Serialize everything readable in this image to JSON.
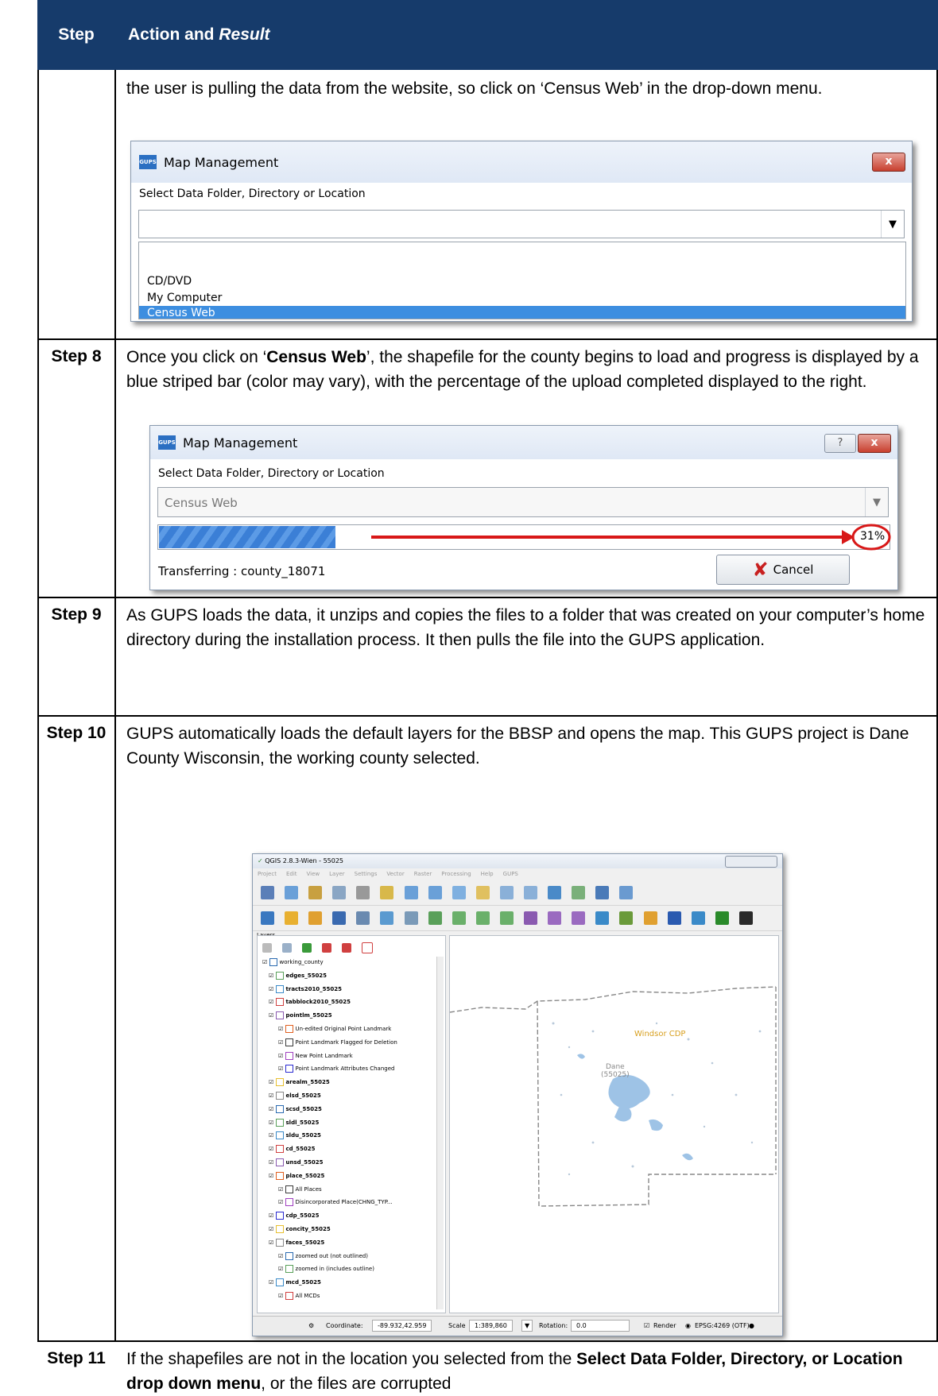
{
  "header": {
    "step": "Step",
    "action": "Action and ",
    "result": "Result"
  },
  "row0": {
    "text": "the user is pulling the data from the website, so click on ‘Census Web’ in the drop-down menu."
  },
  "dialog1": {
    "title": "Map Management",
    "close": "x",
    "label": "Select Data Folder, Directory or Location",
    "options": [
      "CD/DVD",
      "My Computer",
      "Census Web"
    ]
  },
  "step8": {
    "label": "Step 8",
    "t1": "Once you click on ‘",
    "bold": "Census Web",
    "t2": "’, the shapefile for the county begins to load and progress is displayed by a blue striped bar (color may vary), with the percentage of the upload completed displayed to the right."
  },
  "dialog2": {
    "title": "Map Management",
    "help": "?",
    "close": "x",
    "label": "Select Data Folder, Directory or Location",
    "combo_value": "Census Web",
    "progress": 31,
    "percent": "31%",
    "status": "Transferring : county_18071",
    "cancel": "Cancel"
  },
  "step9": {
    "label": "Step 9",
    "text": "As GUPS loads the data, it unzips and copies the files to a folder that was created on your computer’s home directory during the installation process. It then pulls the file into the GUPS application."
  },
  "step10": {
    "label": "Step 10",
    "text": "GUPS automatically loads the default layers for the BBSP and opens the map. This GUPS project is Dane County Wisconsin, the working county selected."
  },
  "qgis": {
    "title": "QGIS 2.8.3-Wien - 55025",
    "menu": [
      "Project",
      "Edit",
      "View",
      "Layer",
      "Settings",
      "Vector",
      "Raster",
      "Processing",
      "Help",
      "GUPS"
    ],
    "panel_title": "Layers",
    "layers": [
      "working_county",
      "edges_55025",
      "tracts2010_55025",
      "tabblock2010_55025",
      "pointlm_55025",
      "Un-edited Original Point Landmark",
      "Point Landmark Flagged for Deletion",
      "New Point Landmark",
      "Point Landmark Attributes Changed",
      "arealm_55025",
      "elsd_55025",
      "scsd_55025",
      "sldl_55025",
      "sldu_55025",
      "cd_55025",
      "unsd_55025",
      "place_55025",
      "All Places",
      "Disincorporated Place(CHNG_TYP...",
      "cdp_55025",
      "concity_55025",
      "faces_55025",
      "zoomed out (not outlined)",
      "zoomed in (includes outline)",
      "mcd_55025",
      "All MCDs"
    ],
    "map_labels": [
      "Windsor CDP",
      "Dane",
      "(55025)"
    ],
    "status": {
      "coord_label": "Coordinate:",
      "coord": "-89.932,42.959",
      "scale_label": "Scale",
      "scale": "1:389,860",
      "rotation_label": "Rotation:",
      "rotation": "0.0",
      "render": "Render",
      "crs": "EPSG:4269 (OTF)"
    }
  },
  "step11": {
    "label": "Step 11",
    "t1": "If the shapefiles are not in the location you selected from the ",
    "bold": "Select Data Folder, Directory, or Location drop down menu",
    "t2": ", or the files are corrupted"
  }
}
